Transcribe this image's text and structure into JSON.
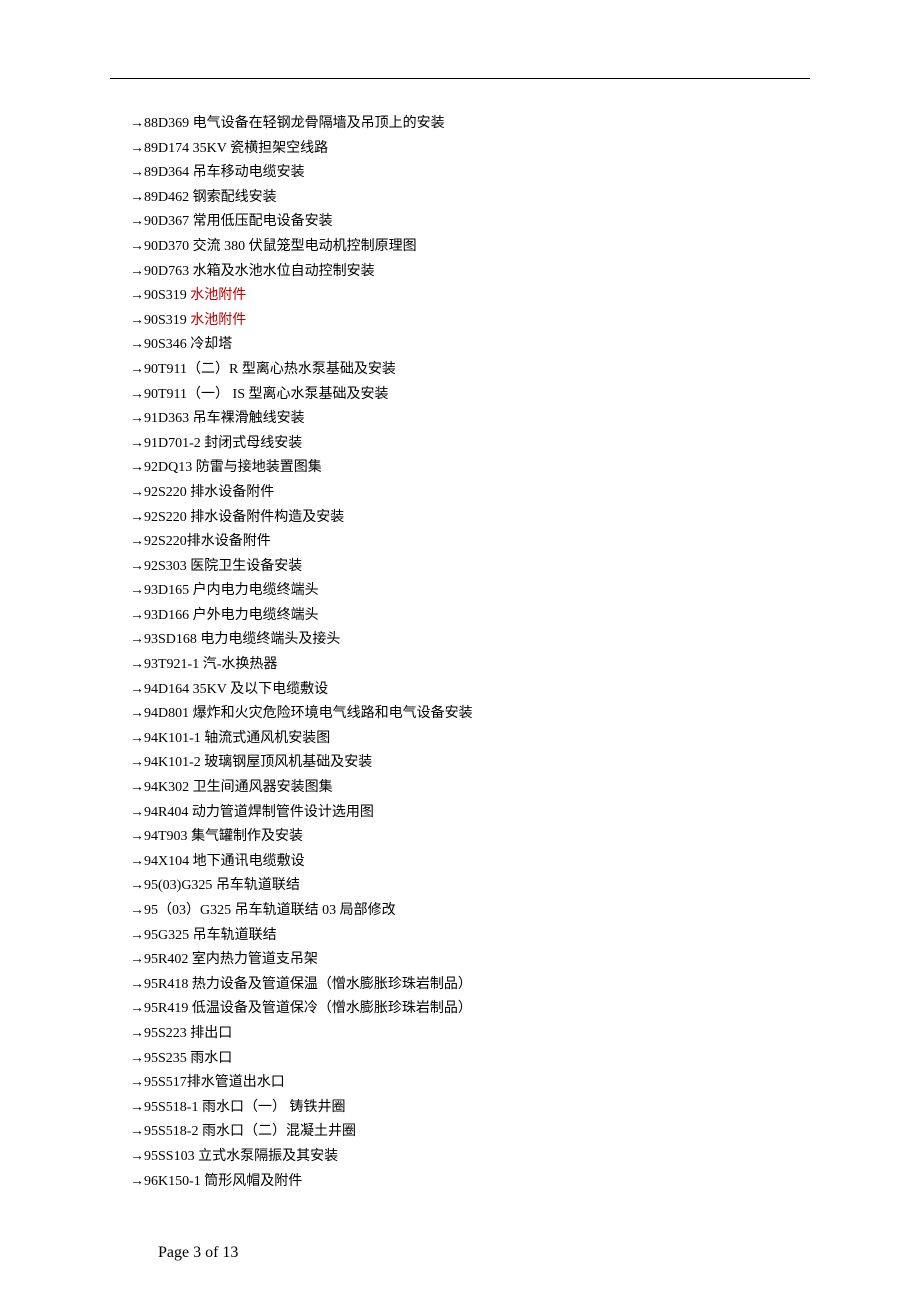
{
  "entries": [
    {
      "code": "88D369",
      "title": "电气设备在轻钢龙骨隔墙及吊顶上的安装",
      "highlight": false
    },
    {
      "code": "89D174",
      "title": "35KV 瓷横担架空线路",
      "highlight": false
    },
    {
      "code": "89D364",
      "title": "吊车移动电缆安装",
      "highlight": false
    },
    {
      "code": "89D462",
      "title": "钢索配线安装",
      "highlight": false
    },
    {
      "code": "90D367",
      "title": "常用低压配电设备安装",
      "highlight": false
    },
    {
      "code": "90D370",
      "title": "交流 380 伏鼠笼型电动机控制原理图",
      "highlight": false
    },
    {
      "code": "90D763",
      "title": "水箱及水池水位自动控制安装",
      "highlight": false
    },
    {
      "code": "90S319",
      "title": "水池附件",
      "highlight": true
    },
    {
      "code": "90S319",
      "title": "水池附件",
      "highlight": true
    },
    {
      "code": "90S346",
      "title": "冷却塔",
      "highlight": false
    },
    {
      "code": "90T911（二）R",
      "title": "型离心热水泵基础及安装",
      "highlight": false,
      "no_gap": true
    },
    {
      "code": "90T911（一）",
      "title": "IS 型离心水泵基础及安装",
      "highlight": false,
      "no_gap": true
    },
    {
      "code": "91D363",
      "title": "吊车裸滑触线安装",
      "highlight": false
    },
    {
      "code": "91D701-2",
      "title": "封闭式母线安装",
      "highlight": false
    },
    {
      "code": "92DQ13",
      "title": "防雷与接地装置图集",
      "highlight": false
    },
    {
      "code": "92S220",
      "title": "排水设备附件",
      "highlight": false
    },
    {
      "code": "92S220",
      "title": "排水设备附件构造及安装",
      "highlight": false
    },
    {
      "code": "92S220",
      "title": "排水设备附件",
      "highlight": false,
      "tight": true
    },
    {
      "code": "92S303",
      "title": "医院卫生设备安装",
      "highlight": false
    },
    {
      "code": "93D165",
      "title": "户内电力电缆终端头",
      "highlight": false
    },
    {
      "code": "93D166",
      "title": "户外电力电缆终端头",
      "highlight": false
    },
    {
      "code": "93SD168",
      "title": "电力电缆终端头及接头",
      "highlight": false
    },
    {
      "code": "93T921-1",
      "title": "汽-水换热器",
      "highlight": false
    },
    {
      "code": "94D164",
      "title": "35KV 及以下电缆敷设",
      "highlight": false
    },
    {
      "code": "94D801",
      "title": "爆炸和火灾危险环境电气线路和电气设备安装",
      "highlight": false
    },
    {
      "code": "94K101-1",
      "title": "轴流式通风机安装图",
      "highlight": false
    },
    {
      "code": "94K101-2",
      "title": "玻璃钢屋顶风机基础及安装",
      "highlight": false
    },
    {
      "code": "94K302",
      "title": "卫生间通风器安装图集",
      "highlight": false
    },
    {
      "code": "94R404",
      "title": "动力管道焊制管件设计选用图",
      "highlight": false
    },
    {
      "code": "94T903",
      "title": "集气罐制作及安装",
      "highlight": false
    },
    {
      "code": "94X104",
      "title": "地下通讯电缆敷设",
      "highlight": false
    },
    {
      "code": "95(03)G325",
      "title": "吊车轨道联结",
      "highlight": false
    },
    {
      "code": "95（03）G325",
      "title": "吊车轨道联结 03 局部修改",
      "highlight": false
    },
    {
      "code": "95G325",
      "title": "吊车轨道联结",
      "highlight": false
    },
    {
      "code": "95R402",
      "title": "室内热力管道支吊架",
      "highlight": false
    },
    {
      "code": "95R418",
      "title": "热力设备及管道保温（憎水膨胀珍珠岩制品）",
      "highlight": false
    },
    {
      "code": "95R419",
      "title": "低温设备及管道保冷（憎水膨胀珍珠岩制品）",
      "highlight": false
    },
    {
      "code": "95S223",
      "title": "排出口",
      "highlight": false
    },
    {
      "code": "95S235",
      "title": "雨水口",
      "highlight": false
    },
    {
      "code": "95S517",
      "title": "排水管道出水口",
      "highlight": false,
      "tight": true
    },
    {
      "code": "95S518-1",
      "title": "雨水口（一） 铸铁井圈",
      "highlight": false
    },
    {
      "code": "95S518-2",
      "title": "雨水口（二）混凝土井圈",
      "highlight": false
    },
    {
      "code": "95SS103",
      "title": "立式水泵隔振及其安装",
      "highlight": false
    },
    {
      "code": "96K150-1",
      "title": "筒形风帽及附件",
      "highlight": false
    }
  ],
  "footer": "Page 3 of 13"
}
